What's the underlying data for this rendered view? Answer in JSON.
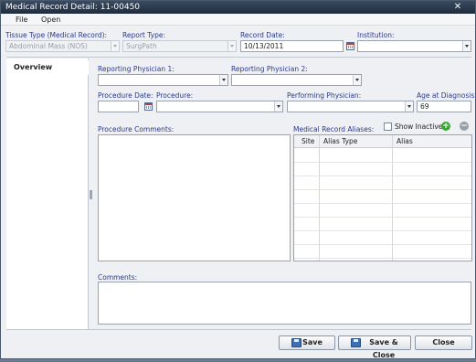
{
  "window": {
    "title": "Medical Record Detail: 11-00450"
  },
  "menu": {
    "file": "File",
    "open": "Open"
  },
  "header": {
    "tissue_type_label": "Tissue Type (Medical Record):",
    "tissue_type_value": "Abdominal Mass (NOS)",
    "report_type_label": "Report Type:",
    "report_type_value": "SurgPath",
    "record_date_label": "Record Date:",
    "record_date_value": "10/13/2011",
    "institution_label": "Institution:",
    "institution_value": ""
  },
  "sidebar": {
    "tab_overview": "Overview"
  },
  "overview": {
    "reporting_physician_1_label": "Reporting Physician 1:",
    "reporting_physician_2_label": "Reporting Physician 2:",
    "procedure_date_label": "Procedure Date:",
    "procedure_label": "Procedure:",
    "performing_physician_label": "Performing Physician:",
    "age_at_diagnosis_label": "Age at Diagnosis:",
    "age_at_diagnosis_value": "69",
    "procedure_comments_label": "Procedure Comments:",
    "medical_record_aliases_label": "Medical Record Aliases:",
    "show_inactive_label": "Show Inactive",
    "aliases_columns": [
      "Site",
      "Alias Type",
      "Alias"
    ],
    "comments_label": "Comments:"
  },
  "footer": {
    "save_label": "Save",
    "save_close_label": "Save & Close",
    "close_label": "Close"
  },
  "colors": {
    "title_bar": "#1f2c3d",
    "label_blue": "#2a3a8c",
    "add_green": "#3aa535",
    "remove_gray": "#9aa0a8"
  },
  "icons": {
    "close": "close-icon",
    "calendar": "calendar-icon",
    "add": "add-icon",
    "remove": "remove-icon",
    "save": "save-disk-icon"
  }
}
